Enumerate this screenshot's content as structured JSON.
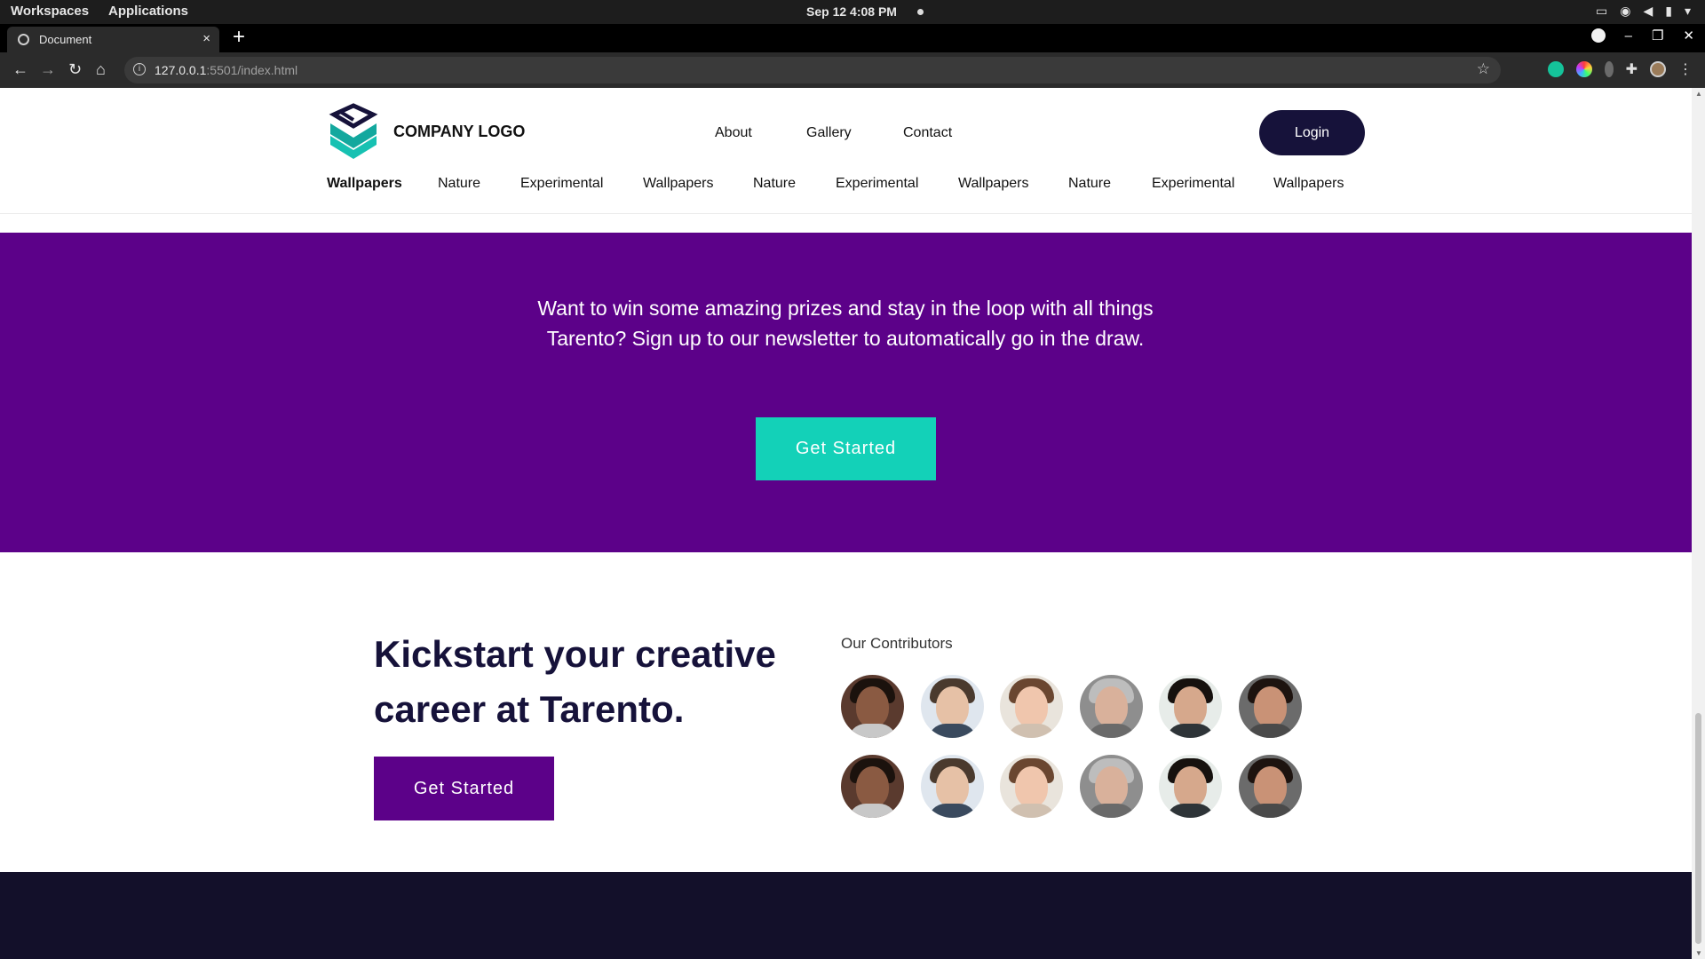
{
  "system_bar": {
    "workspaces": "Workspaces",
    "applications": "Applications",
    "clock": "Sep 12   4:08 PM"
  },
  "browser": {
    "tab_title": "Document",
    "url_host": "127.0.0.1",
    "url_rest": ":5501/index.html"
  },
  "header": {
    "logo_text": "COMPANY LOGO",
    "nav": [
      "About",
      "Gallery",
      "Contact"
    ],
    "login": "Login",
    "categories": [
      "Wallpapers",
      "Nature",
      "Experimental",
      "Wallpapers",
      "Nature",
      "Experimental",
      "Wallpapers",
      "Nature",
      "Experimental",
      "Wallpapers"
    ]
  },
  "newsletter": {
    "text": "Want to win some amazing prizes and stay in the loop with all things Tarento? Sign up to our newsletter to automatically go in the draw.",
    "button": "Get Started"
  },
  "kickstart": {
    "heading": "Kickstart your creative career at Tarento.",
    "button": "Get Started",
    "contributors_title": "Our Contributors"
  },
  "colors": {
    "purple": "#5c0189",
    "teal": "#13d1b8",
    "navy": "#16123a",
    "footer": "#13102a"
  }
}
